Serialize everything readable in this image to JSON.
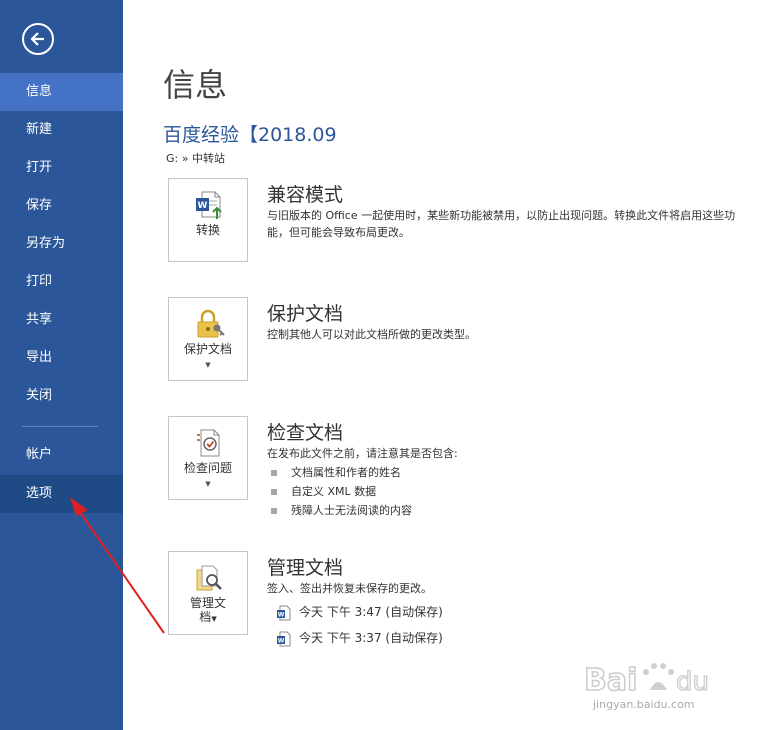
{
  "sidebar": {
    "back_icon": "back-arrow-icon",
    "items": [
      {
        "label": "信息"
      },
      {
        "label": "新建"
      },
      {
        "label": "打开"
      },
      {
        "label": "保存"
      },
      {
        "label": "另存为"
      },
      {
        "label": "打印"
      },
      {
        "label": "共享"
      },
      {
        "label": "导出"
      },
      {
        "label": "关闭"
      },
      {
        "label": "帐户"
      },
      {
        "label": "选项"
      }
    ],
    "active_item": "信息",
    "highlighted_item": "选项"
  },
  "main": {
    "title": "信息",
    "doc_name": "百度经验【2018.09",
    "doc_path": "G: » 中转站",
    "sections": [
      {
        "button_label": "转换",
        "button_icon": "word-convert-icon",
        "title": "兼容模式",
        "desc": "与旧版本的 Office 一起使用时，某些新功能被禁用，以防止出现问题。转换此文件将启用这些功能，但可能会导致布局更改。"
      },
      {
        "button_label": "保护文档",
        "button_icon": "lock-key-icon",
        "title": "保护文档",
        "desc": "控制其他人可以对此文档所做的更改类型。"
      },
      {
        "button_label": "检查问题",
        "button_icon": "inspect-document-icon",
        "title": "检查文档",
        "desc": "在发布此文件之前，请注意其是否包含:",
        "bullets": [
          "文档属性和作者的姓名",
          "自定义 XML 数据",
          "残障人士无法阅读的内容"
        ]
      },
      {
        "button_label_line1": "管理文",
        "button_label_line2": "档",
        "button_icon": "manage-document-icon",
        "title": "管理文档",
        "desc": "签入、签出并恢复未保存的更改。",
        "versions": [
          "今天 下午 3:47 (自动保存)",
          "今天 下午 3:37 (自动保存)"
        ]
      }
    ]
  },
  "watermark": {
    "text": "jingyan.baidu.com"
  },
  "colors": {
    "sidebar": "#2b579a",
    "active": "#4472c4",
    "hover": "#1e4a86",
    "accent": "#2b579a",
    "arrow": "#e02020"
  }
}
